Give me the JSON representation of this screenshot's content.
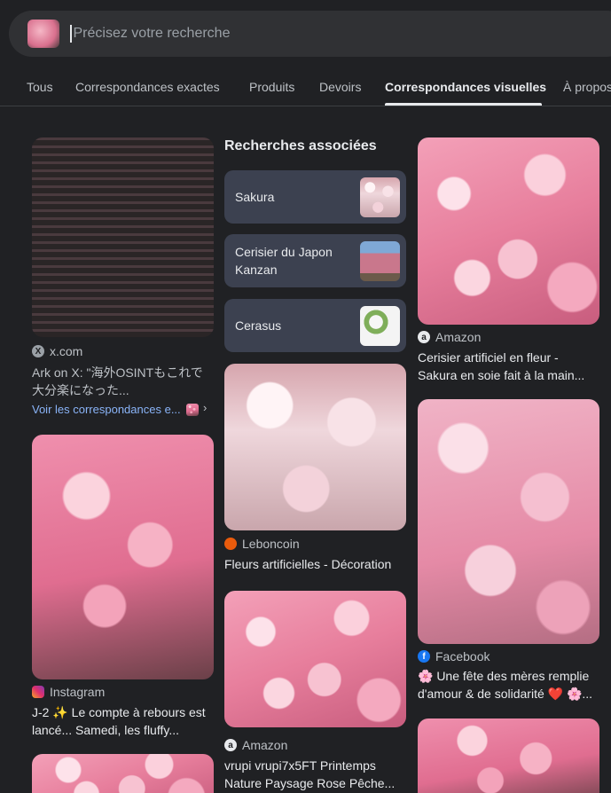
{
  "search": {
    "placeholder": "Précisez votre recherche"
  },
  "tabs": [
    {
      "label": "Tous"
    },
    {
      "label": "Correspondances exactes"
    },
    {
      "label": "Produits"
    },
    {
      "label": "Devoirs"
    },
    {
      "label": "Correspondances visuelles",
      "active": true
    },
    {
      "label": "À propos"
    }
  ],
  "col1": {
    "card1": {
      "source": "x.com",
      "title": "Ark on X: \"海外OSINTもこれで大分楽になった...",
      "link": "Voir les correspondances e..."
    },
    "card2": {
      "source": "Instagram",
      "title_line1": "J-2 ✨ Le compte à rebours est",
      "title_line2": "lancé... Samedi, les fluffy..."
    }
  },
  "related": {
    "heading": "Recherches associées",
    "items": [
      {
        "label": "Sakura"
      },
      {
        "label": "Cerisier du Japon Kanzan"
      },
      {
        "label": "Cerasus"
      }
    ]
  },
  "col2": {
    "card1": {
      "source": "Leboncoin",
      "title": "Fleurs artificielles - Décoration"
    },
    "card2": {
      "source": "Amazon",
      "title_line1": "vrupi vrupi7x5FT Printemps",
      "title_line2": "Nature Paysage Rose Pêche..."
    }
  },
  "col3": {
    "card1": {
      "source": "Amazon",
      "title_line1": "Cerisier artificiel en fleur -",
      "title_line2": "Sakura en soie fait à la main..."
    },
    "card2": {
      "source": "Facebook",
      "title_line1": "🌸 Une fête des mères remplie",
      "title_line2": "d'amour & de solidarité ❤️ 🌸..."
    }
  },
  "colors": {
    "background": "#202124",
    "searchbar": "#303134",
    "related_card": "#3c4150",
    "amazon": "#ff9900",
    "facebook": "#1877f2",
    "instagram": "#e1306c",
    "leboncoin": "#ea5b0c"
  }
}
